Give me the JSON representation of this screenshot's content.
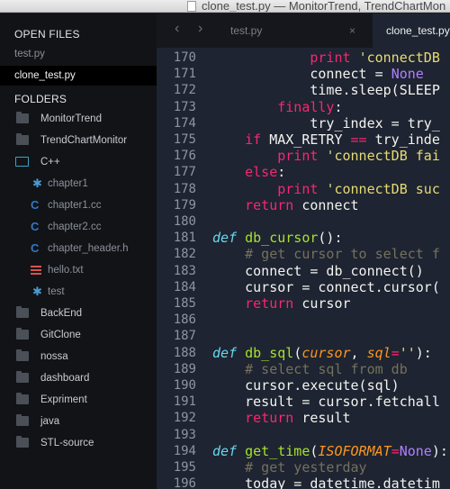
{
  "window": {
    "title": "clone_test.py — MonitorTrend, TrendChartMon"
  },
  "sidebar": {
    "open_files_heading": "OPEN FILES",
    "open_files": [
      {
        "label": "test.py",
        "active": false
      },
      {
        "label": "clone_test.py",
        "active": true
      }
    ],
    "folders_heading": "FOLDERS",
    "tree": [
      {
        "label": "MonitorTrend",
        "icon": "folder-icon",
        "depth": 0
      },
      {
        "label": "TrendChartMonitor",
        "icon": "folder-icon",
        "depth": 0
      },
      {
        "label": "C++",
        "icon": "folder-open-icon",
        "depth": 0
      },
      {
        "label": "chapter1",
        "icon": "asterisk-file-icon",
        "depth": 1
      },
      {
        "label": "chapter1.cc",
        "icon": "cpp-file-icon",
        "depth": 1
      },
      {
        "label": "chapter2.cc",
        "icon": "cpp-file-icon",
        "depth": 1
      },
      {
        "label": "chapter_header.h",
        "icon": "cpp-file-icon",
        "depth": 1
      },
      {
        "label": "hello.txt",
        "icon": "text-file-icon",
        "depth": 1
      },
      {
        "label": "test",
        "icon": "asterisk-file-icon",
        "depth": 1
      },
      {
        "label": "BackEnd",
        "icon": "folder-icon",
        "depth": 0
      },
      {
        "label": "GitClone",
        "icon": "folder-icon",
        "depth": 0
      },
      {
        "label": "nossa",
        "icon": "folder-icon",
        "depth": 0
      },
      {
        "label": "dashboard",
        "icon": "folder-icon",
        "depth": 0
      },
      {
        "label": "Expriment",
        "icon": "folder-icon",
        "depth": 0
      },
      {
        "label": "java",
        "icon": "folder-icon",
        "depth": 0
      },
      {
        "label": "STL-source",
        "icon": "folder-icon",
        "depth": 0
      }
    ]
  },
  "tabs": {
    "back_arrow": "‹",
    "forward_arrow": "›",
    "items": [
      {
        "label": "test.py",
        "active": false,
        "close": "×"
      },
      {
        "label": "clone_test.py",
        "active": true,
        "close": "×"
      }
    ]
  },
  "editor": {
    "lines": [
      {
        "n": "170",
        "tokens": [
          {
            "t": "            "
          },
          {
            "c": "kw",
            "t": "print"
          },
          {
            "t": " "
          },
          {
            "c": "st",
            "t": "'connectDB"
          }
        ]
      },
      {
        "n": "171",
        "tokens": [
          {
            "t": "            connect = "
          },
          {
            "c": "nm",
            "t": "None"
          }
        ]
      },
      {
        "n": "172",
        "tokens": [
          {
            "t": "            time.sleep(SLEEP"
          }
        ]
      },
      {
        "n": "173",
        "tokens": [
          {
            "t": "        "
          },
          {
            "c": "kw",
            "t": "finally"
          },
          {
            "t": ":"
          }
        ]
      },
      {
        "n": "174",
        "tokens": [
          {
            "t": "            try_index = try_"
          }
        ]
      },
      {
        "n": "175",
        "tokens": [
          {
            "t": "    "
          },
          {
            "c": "kw",
            "t": "if"
          },
          {
            "t": " MAX_RETRY "
          },
          {
            "c": "kw",
            "t": "=="
          },
          {
            "t": " try_inde"
          }
        ]
      },
      {
        "n": "176",
        "tokens": [
          {
            "t": "        "
          },
          {
            "c": "kw",
            "t": "print"
          },
          {
            "t": " "
          },
          {
            "c": "st",
            "t": "'connectDB fai"
          }
        ]
      },
      {
        "n": "177",
        "tokens": [
          {
            "t": "    "
          },
          {
            "c": "kw",
            "t": "else"
          },
          {
            "t": ":"
          }
        ]
      },
      {
        "n": "178",
        "tokens": [
          {
            "t": "        "
          },
          {
            "c": "kw",
            "t": "print"
          },
          {
            "t": " "
          },
          {
            "c": "st",
            "t": "'connectDB suc"
          }
        ]
      },
      {
        "n": "179",
        "tokens": [
          {
            "t": "    "
          },
          {
            "c": "kw",
            "t": "return"
          },
          {
            "t": " connect"
          }
        ]
      },
      {
        "n": "180",
        "tokens": []
      },
      {
        "n": "181",
        "tokens": [
          {
            "c": "df",
            "t": "def"
          },
          {
            "t": " "
          },
          {
            "c": "fn",
            "t": "db_cursor"
          },
          {
            "t": "():"
          }
        ]
      },
      {
        "n": "182",
        "tokens": [
          {
            "t": "    "
          },
          {
            "c": "cm",
            "t": "# get cursor to select f"
          }
        ]
      },
      {
        "n": "183",
        "tokens": [
          {
            "t": "    connect = db_connect()"
          }
        ]
      },
      {
        "n": "184",
        "tokens": [
          {
            "t": "    cursor = connect.cursor("
          }
        ]
      },
      {
        "n": "185",
        "tokens": [
          {
            "t": "    "
          },
          {
            "c": "kw",
            "t": "return"
          },
          {
            "t": " cursor"
          }
        ]
      },
      {
        "n": "186",
        "tokens": []
      },
      {
        "n": "187",
        "tokens": []
      },
      {
        "n": "188",
        "tokens": [
          {
            "c": "df",
            "t": "def"
          },
          {
            "t": " "
          },
          {
            "c": "fn",
            "t": "db_sql"
          },
          {
            "t": "("
          },
          {
            "c": "pm",
            "t": "cursor"
          },
          {
            "t": ", "
          },
          {
            "c": "pm",
            "t": "sql"
          },
          {
            "c": "kw",
            "t": "="
          },
          {
            "c": "st",
            "t": "''"
          },
          {
            "t": "):"
          }
        ]
      },
      {
        "n": "189",
        "tokens": [
          {
            "t": "    "
          },
          {
            "c": "cm",
            "t": "# select sql from db"
          }
        ]
      },
      {
        "n": "190",
        "tokens": [
          {
            "t": "    cursor.execute(sql)"
          }
        ]
      },
      {
        "n": "191",
        "tokens": [
          {
            "t": "    result = cursor.fetchall"
          }
        ]
      },
      {
        "n": "192",
        "tokens": [
          {
            "t": "    "
          },
          {
            "c": "kw",
            "t": "return"
          },
          {
            "t": " result"
          }
        ]
      },
      {
        "n": "193",
        "tokens": []
      },
      {
        "n": "194",
        "tokens": [
          {
            "c": "df",
            "t": "def"
          },
          {
            "t": " "
          },
          {
            "c": "fn",
            "t": "get_time"
          },
          {
            "t": "("
          },
          {
            "c": "pm",
            "t": "ISOFORMAT"
          },
          {
            "c": "kw",
            "t": "="
          },
          {
            "c": "nm",
            "t": "None"
          },
          {
            "t": "):"
          }
        ]
      },
      {
        "n": "195",
        "tokens": [
          {
            "t": "    "
          },
          {
            "c": "cm",
            "t": "# get yesterday"
          }
        ]
      },
      {
        "n": "196",
        "tokens": [
          {
            "t": "    today = datetime.datetim"
          }
        ]
      }
    ]
  },
  "colors": {
    "sidebar_bg": "#111317",
    "editor_bg": "#1e2431",
    "keyword": "#f92672",
    "function": "#a6e22e",
    "string": "#e6db74",
    "comment": "#75715e",
    "param": "#fd971f",
    "def": "#66d9ef",
    "constant": "#ae81ff"
  }
}
